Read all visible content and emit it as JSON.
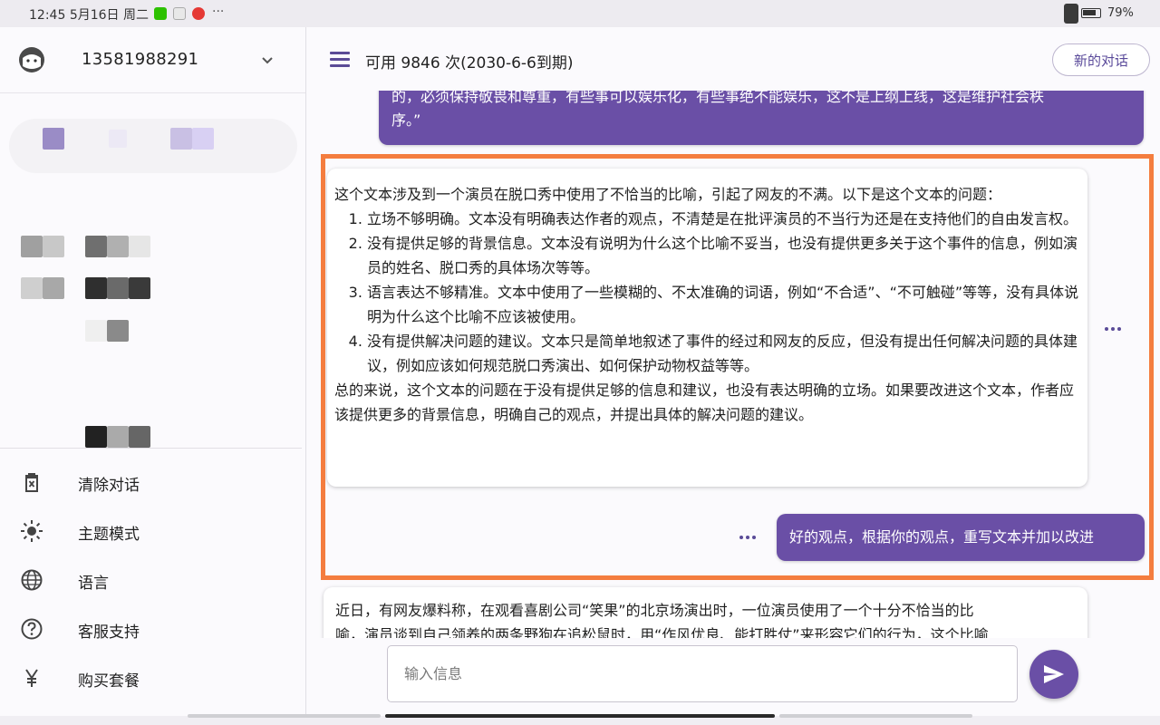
{
  "status_bar": {
    "time": "12:45",
    "date": "5月16日",
    "weekday": "周二",
    "more": "···",
    "battery": "79%"
  },
  "sidebar": {
    "account": "13581988291",
    "menu": [
      {
        "icon": "trash-icon",
        "label": "清除对话"
      },
      {
        "icon": "theme-icon",
        "label": "主题模式"
      },
      {
        "icon": "globe-icon",
        "label": "语言"
      },
      {
        "icon": "help-icon",
        "label": "客服支持"
      },
      {
        "icon": "yen-icon",
        "label": "购买套餐"
      }
    ]
  },
  "header": {
    "title": "可用 9846 次(2030-6-6到期)",
    "new_chat": "新的对话"
  },
  "messages": {
    "user_partial": {
      "line1": "的，必须保持敬畏和尊重，有些事可以娱乐化，有些事绝不能娱乐，这不是上纲上线，这是维护社会秩",
      "line2": "序。”"
    },
    "bot_reply": {
      "intro": "这个文本涉及到一个演员在脱口秀中使用了不恰当的比喻，引起了网友的不满。以下是这个文本的问题：",
      "items": [
        "立场不够明确。文本没有明确表达作者的观点，不清楚是在批评演员的不当行为还是在支持他们的自由发言权。",
        "没有提供足够的背景信息。文本没有说明为什么这个比喻不妥当，也没有提供更多关于这个事件的信息，例如演员的姓名、脱口秀的具体场次等等。",
        "语言表达不够精准。文本中使用了一些模糊的、不太准确的词语，例如“不合适”、“不可触碰”等等，没有具体说明为什么这个比喻不应该被使用。",
        "没有提供解决问题的建议。文本只是简单地叙述了事件的经过和网友的反应，但没有提出任何解决问题的具体建议，例如应该如何规范脱口秀演出、如何保护动物权益等等。"
      ],
      "summary": "总的来说，这个文本的问题在于没有提供足够的信息和建议，也没有表达明确的立场。如果要改进这个文本，作者应该提供更多的背景信息，明确自己的观点，并提出具体的解决问题的建议。"
    },
    "user_followup": "好的观点，根据你的观点，重写文本并加以改进",
    "bot_partial": {
      "line1": "近日，有网友爆料称，在观看喜剧公司“笑果”的北京场演出时，一位演员使用了一个十分不恰当的比",
      "line2": "喻，演员谈到自己领养的两条野狗在追松鼠时，用“作风优良、能打胜仗”来形容它们的行为，这个比喻"
    }
  },
  "input": {
    "placeholder": "输入信息"
  },
  "colors": {
    "accent": "#6a4fa6",
    "highlight": "#f47d3f"
  }
}
